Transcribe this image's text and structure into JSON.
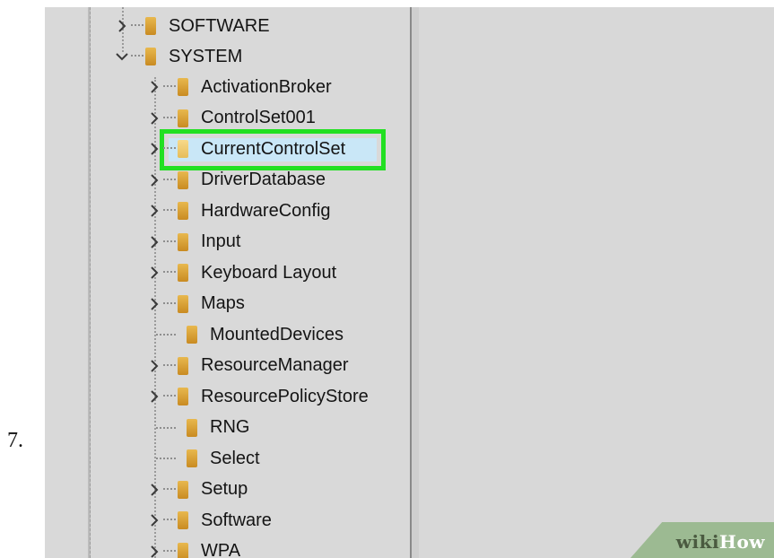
{
  "step_number": "7.",
  "tree": {
    "top_items": [
      {
        "label": "SOFTWARE",
        "expander": "collapsed"
      },
      {
        "label": "SYSTEM",
        "expander": "expanded"
      }
    ],
    "system_children": [
      {
        "label": "ActivationBroker",
        "expander": "collapsed"
      },
      {
        "label": "ControlSet001",
        "expander": "collapsed"
      },
      {
        "label": "CurrentControlSet",
        "expander": "collapsed",
        "selected": true
      },
      {
        "label": "DriverDatabase",
        "expander": "collapsed"
      },
      {
        "label": "HardwareConfig",
        "expander": "collapsed"
      },
      {
        "label": "Input",
        "expander": "collapsed"
      },
      {
        "label": "Keyboard Layout",
        "expander": "collapsed"
      },
      {
        "label": "Maps",
        "expander": "collapsed"
      },
      {
        "label": "MountedDevices",
        "expander": "none"
      },
      {
        "label": "ResourceManager",
        "expander": "collapsed"
      },
      {
        "label": "ResourcePolicyStore",
        "expander": "collapsed"
      },
      {
        "label": "RNG",
        "expander": "none"
      },
      {
        "label": "Select",
        "expander": "none"
      },
      {
        "label": "Setup",
        "expander": "collapsed"
      },
      {
        "label": "Software",
        "expander": "collapsed"
      },
      {
        "label": "WPA",
        "expander": "collapsed"
      }
    ]
  },
  "watermark": {
    "part1": "wiki",
    "part2": "How"
  },
  "colors": {
    "highlight": "#22e022",
    "folder": "#d9a030",
    "background": "#d9d9d9"
  },
  "icons": {
    "collapsed": "chevron-right-icon",
    "expanded": "chevron-down-icon",
    "folder": "folder-icon"
  }
}
